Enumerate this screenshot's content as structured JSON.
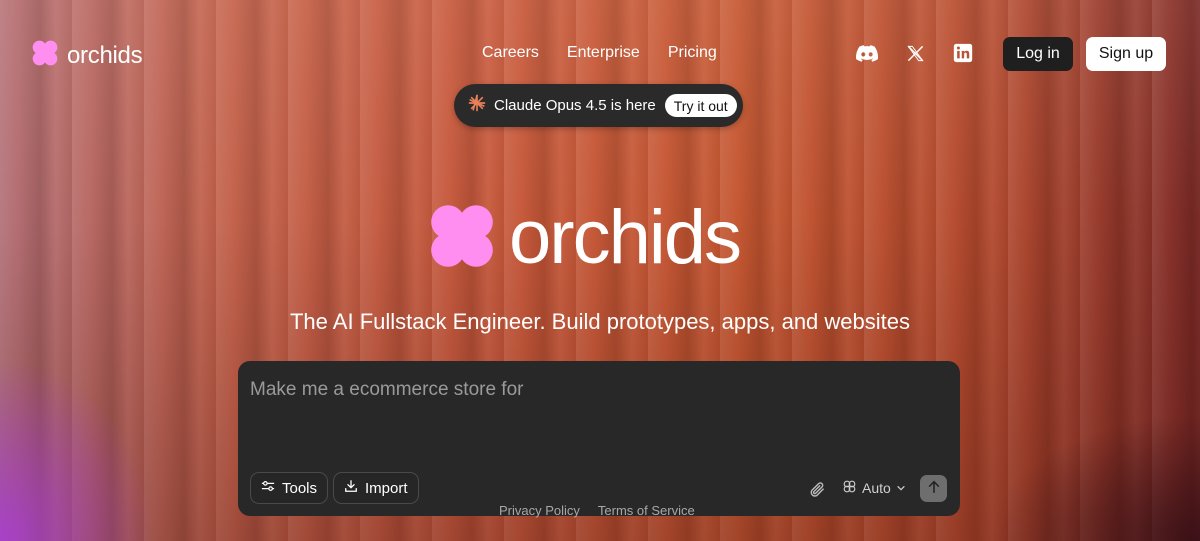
{
  "brand": {
    "name": "orchids",
    "logo_color": "#ff8ef0"
  },
  "nav": {
    "items": [
      "Careers",
      "Enterprise",
      "Pricing"
    ]
  },
  "socials": [
    "discord-icon",
    "x-icon",
    "linkedin-icon"
  ],
  "auth": {
    "login_label": "Log in",
    "signup_label": "Sign up"
  },
  "announcement": {
    "text": "Claude Opus 4.5 is here",
    "cta": "Try it out",
    "icon": "claude-star-icon",
    "icon_color": "#e8805a"
  },
  "hero": {
    "word": "orchids",
    "tagline": "The AI Fullstack Engineer. Build prototypes, apps, and websites"
  },
  "prompt": {
    "placeholder": "Make me a ecommerce store for",
    "tools_label": "Tools",
    "import_label": "Import",
    "model_label": "Auto"
  },
  "footer": {
    "privacy": "Privacy Policy",
    "terms": "Terms of Service"
  }
}
